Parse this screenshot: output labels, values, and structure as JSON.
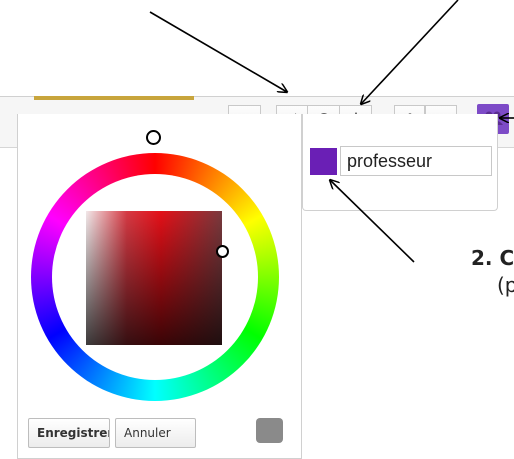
{
  "toolbar": {
    "buttons": [
      {
        "icon": "dashboard-icon"
      },
      {
        "icon": "swap-arrows-icon"
      },
      {
        "icon": "clock-icon"
      },
      {
        "icon": "star-icon"
      },
      {
        "icon": "gear-icon"
      },
      {
        "icon": "code-icon"
      },
      {
        "icon": "users-icon",
        "color": "#7d4bc7"
      }
    ]
  },
  "color_picker": {
    "save_label": "Enregistrer",
    "cancel_label": "Annuler",
    "preview_color": "#8a8a8a"
  },
  "color_dropdown": {
    "swatch_color": "#6a1fb5",
    "name_value": "professeur"
  },
  "instruction": {
    "step_text": "2. C",
    "paren_text": "(p"
  }
}
